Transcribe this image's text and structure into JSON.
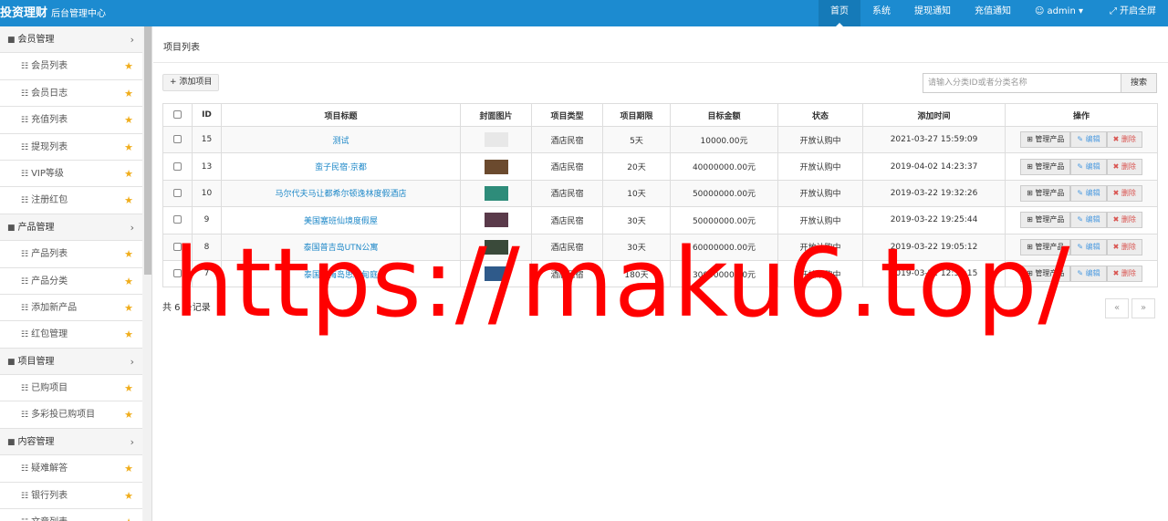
{
  "header": {
    "brand_main": "投资理财",
    "brand_sub": "后台管理中心",
    "nav": [
      {
        "label": "首页",
        "active": true,
        "icon": ""
      },
      {
        "label": "系统",
        "active": false,
        "icon": ""
      },
      {
        "label": "提现通知",
        "active": false,
        "icon": ""
      },
      {
        "label": "充值通知",
        "active": false,
        "icon": ""
      },
      {
        "label": "admin",
        "active": false,
        "icon": "user-icon"
      },
      {
        "label": "开启全屏",
        "active": false,
        "icon": "fullscreen-icon"
      }
    ]
  },
  "sidebar": {
    "groups": [
      {
        "label": "会员管理",
        "items": [
          "会员列表",
          "会员日志",
          "充值列表",
          "提现列表",
          "VIP等级",
          "注册红包"
        ]
      },
      {
        "label": "产品管理",
        "items": [
          "产品列表",
          "产品分类",
          "添加新产品",
          "红包管理"
        ]
      },
      {
        "label": "项目管理",
        "items": [
          "已购项目",
          "多彩投已购项目"
        ]
      },
      {
        "label": "内容管理",
        "items": [
          "疑难解答",
          "银行列表",
          "文章列表"
        ]
      }
    ]
  },
  "main": {
    "page_title": "项目列表",
    "add_button": "添加项目",
    "search_placeholder": "请输入分类ID或者分类名称",
    "search_button": "搜索",
    "columns": [
      "",
      "ID",
      "项目标题",
      "封面图片",
      "项目类型",
      "项目期限",
      "目标金额",
      "状态",
      "添加时间",
      "操作"
    ],
    "rows": [
      {
        "id": "15",
        "title": "测试",
        "type": "酒店民宿",
        "term": "5天",
        "amount": "10000.00元",
        "status": "开放认购中",
        "time": "2021-03-27 15:59:09",
        "thumb": "#e8e8e8"
      },
      {
        "id": "13",
        "title": "蛮子民宿·京都",
        "type": "酒店民宿",
        "term": "20天",
        "amount": "40000000.00元",
        "status": "开放认购中",
        "time": "2019-04-02 14:23:37",
        "thumb": "#6b4a2e"
      },
      {
        "id": "10",
        "title": "马尔代夫马让都希尔顿逸林度假酒店",
        "type": "酒店民宿",
        "term": "10天",
        "amount": "50000000.00元",
        "status": "开放认购中",
        "time": "2019-03-22 19:32:26",
        "thumb": "#2e8c7a"
      },
      {
        "id": "9",
        "title": "美国塞班仙境度假屋",
        "type": "酒店民宿",
        "term": "30天",
        "amount": "50000000.00元",
        "status": "开放认购中",
        "time": "2019-03-22 19:25:44",
        "thumb": "#5a3a4a"
      },
      {
        "id": "8",
        "title": "泰国普吉岛UTN公寓",
        "type": "酒店民宿",
        "term": "30天",
        "amount": "60000000.00元",
        "status": "开放认购中",
        "time": "2019-03-22 19:05:12",
        "thumb": "#3a4a3a"
      },
      {
        "id": "7",
        "title": "泰国苏梅岛思綝甸庭",
        "type": "酒店民宿",
        "term": "180天",
        "amount": "30000000.00元",
        "status": "开放认购中",
        "time": "2019-03-22 12:31:15",
        "thumb": "#2f5a8a"
      }
    ],
    "ops": {
      "manage": "管理产品",
      "edit": "编辑",
      "delete": "删除"
    },
    "record_count": "共 6 条记录",
    "pager_prev": "«",
    "pager_next": "»"
  },
  "watermark": "https://maku6.top/",
  "colors": {
    "topbar": "#1c8bd0",
    "link": "#1e88c8",
    "star": "#f0ad1c",
    "delete": "#d9534f",
    "watermark": "#ff0000"
  }
}
